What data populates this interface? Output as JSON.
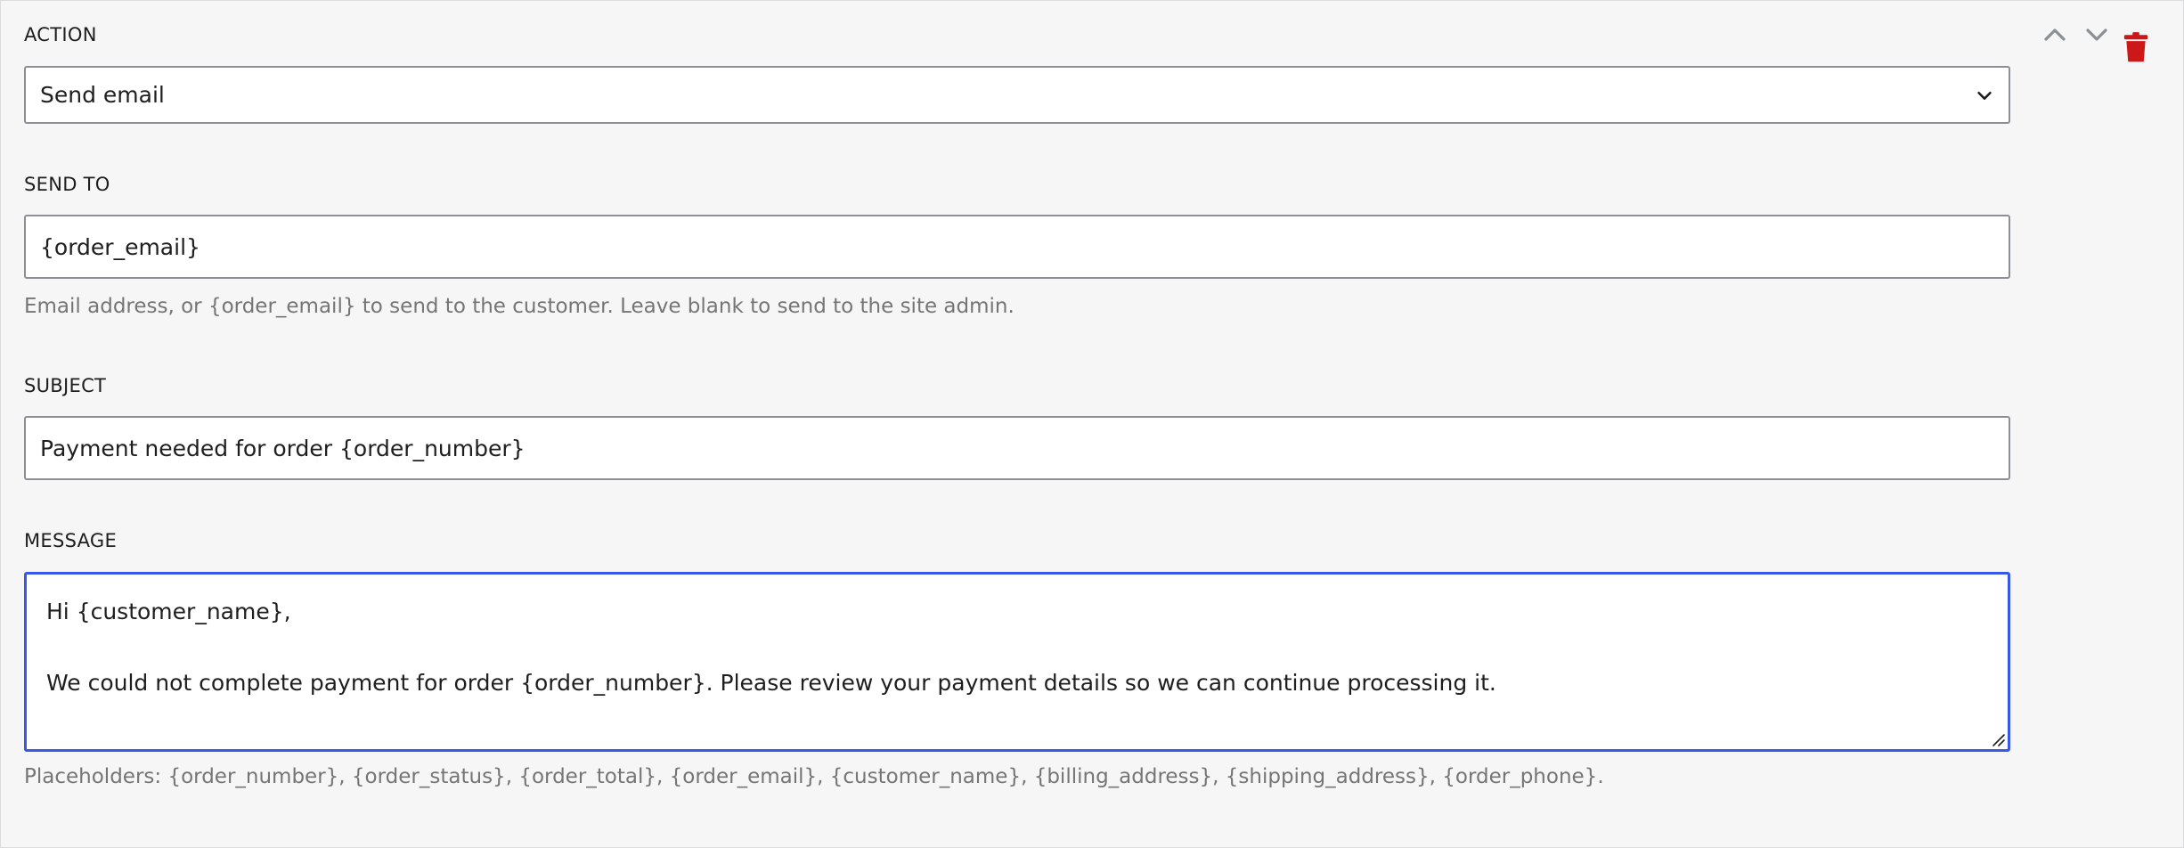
{
  "action": {
    "label": "ACTION",
    "selected": "Send email"
  },
  "send_to": {
    "label": "SEND TO",
    "value": "{order_email}",
    "help": "Email address, or {order_email} to send to the customer. Leave blank to send to the site admin."
  },
  "subject": {
    "label": "SUBJECT",
    "value": "Payment needed for order {order_number}"
  },
  "message": {
    "label": "MESSAGE",
    "lines": [
      "Hi {customer_name},",
      "",
      "We could not complete payment for order {order_number}. Please review your payment details so we can continue processing it."
    ],
    "help": "Placeholders: {order_number}, {order_status}, {order_total}, {order_email}, {customer_name}, {billing_address}, {shipping_address}, {order_phone}."
  },
  "controls": {
    "move_up_icon": "chevron-up-icon",
    "move_down_icon": "chevron-down-icon",
    "delete_icon": "trash-icon",
    "delete_color": "#cc1818",
    "arrow_color": "#8c8f94",
    "focus_color": "#3858e9"
  }
}
